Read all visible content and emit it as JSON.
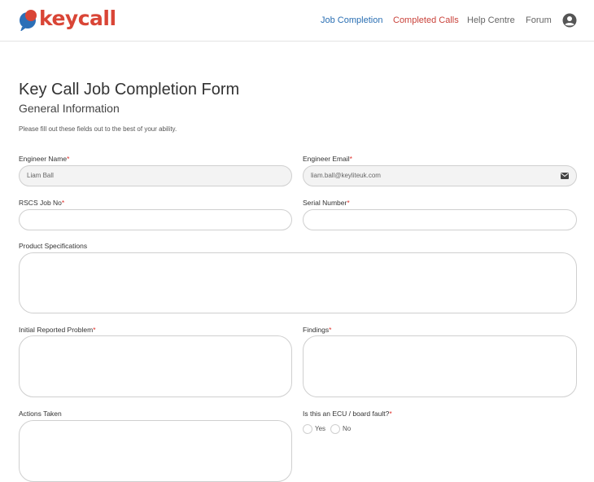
{
  "header": {
    "logo_text": "keycall",
    "nav": [
      "Job Completion",
      "Completed Calls",
      "Help Centre",
      "Forum"
    ],
    "user_icon": "user-circle-icon",
    "colors": {
      "brand": "#d94536",
      "active_nav": "#2a6fb3",
      "secondary_nav": "#c9423a"
    }
  },
  "form": {
    "title": "Key Call Job Completion Form",
    "subtitle": "General Information",
    "intro": "Please fill out these fields out to the best of your ability.",
    "required_marker": "*",
    "engineer_name": {
      "label": "Engineer Name",
      "value": "Liam Ball"
    },
    "engineer_email": {
      "label": "Engineer Email",
      "value": "liam.ball@keyliteuk.com",
      "icon": "envelope-icon"
    },
    "rscs_job_no": {
      "label": "RSCS Job No",
      "value": ""
    },
    "serial_number": {
      "label": "Serial Number",
      "value": ""
    },
    "product_specifications": {
      "label": "Product Specifications",
      "value": ""
    },
    "initial_reported_problem": {
      "label": "Initial Reported Problem",
      "value": ""
    },
    "findings": {
      "label": "Findings",
      "value": ""
    },
    "actions_taken": {
      "label": "Actions Taken",
      "value": ""
    },
    "ecu_board_fault": {
      "label": "Is this an ECU / board fault?",
      "options": [
        "Yes",
        "No"
      ]
    }
  }
}
